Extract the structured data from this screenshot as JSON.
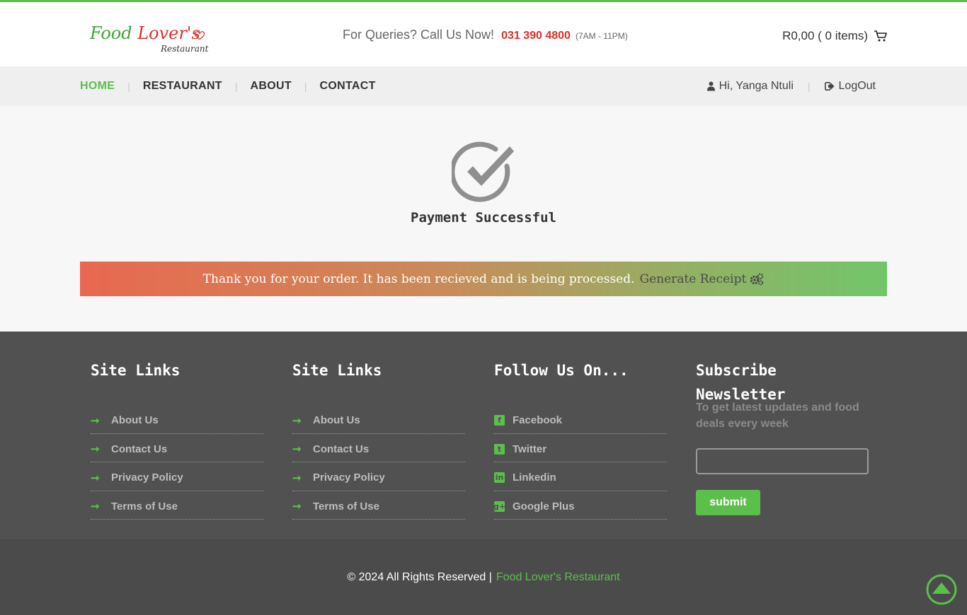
{
  "brand": {
    "logo_part1": "Food ",
    "logo_part2": "Lover's",
    "logo_sub": "Restaurant",
    "accent": "#5cbf4c",
    "red": "#d8322a"
  },
  "header": {
    "queries_label": "For Queries? Call Us Now!",
    "phone": "031 390 4800",
    "hours": "(7AM - 11PM)",
    "cart_text": "R0,00 ( 0 items)"
  },
  "nav": {
    "items": [
      {
        "label": "HOME",
        "active": true
      },
      {
        "label": "RESTAURANT"
      },
      {
        "label": "ABOUT"
      },
      {
        "label": "CONTACT"
      }
    ],
    "sep": "|",
    "user_greeting": "Hi, Yanga Ntuli",
    "logout": "LogOut"
  },
  "main": {
    "title": "Payment Successful",
    "banner_text": "Thank you for your order. It has been recieved and is being processed.",
    "receipt_link": "Generate Receipt"
  },
  "footer": {
    "col1": {
      "title": "Site Links",
      "links": [
        "About Us",
        "Contact Us",
        "Privacy Policy",
        "Terms of Use"
      ]
    },
    "col2": {
      "title": "Site Links",
      "links": [
        "About Us",
        "Contact Us",
        "Privacy Policy",
        "Terms of Use"
      ]
    },
    "col3": {
      "title": "Follow Us On...",
      "links": [
        "Facebook",
        "Twitter",
        "Linkedin",
        "Google Plus"
      ],
      "icons": [
        "facebook-icon",
        "twitter-icon",
        "linkedin-icon",
        "google-plus-icon"
      ]
    },
    "col4": {
      "title": "Subscribe Newsletter",
      "text": "To get latest updates and food deals every week",
      "input_value": "",
      "submit": "submit"
    }
  },
  "copyright": {
    "text": "© 2024 All Rights Reserved |",
    "brand": "Food Lover's Restaurant"
  }
}
